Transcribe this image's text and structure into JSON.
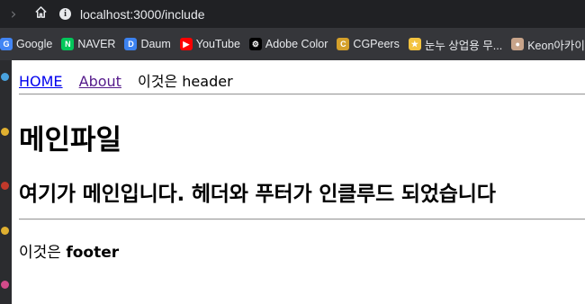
{
  "browser": {
    "url": "localhost:3000/include",
    "bookmarks": [
      {
        "label": "Google",
        "icon": "google-icon",
        "color": "#4285f4"
      },
      {
        "label": "NAVER",
        "icon": "naver-icon",
        "color": "#03c75a"
      },
      {
        "label": "Daum",
        "icon": "daum-icon",
        "color": "#3c82f0"
      },
      {
        "label": "YouTube",
        "icon": "youtube-icon",
        "color": "#ff0000"
      },
      {
        "label": "Adobe Color",
        "icon": "adobe-color-icon",
        "color": "#000000"
      },
      {
        "label": "CGPeers",
        "icon": "cgpeers-icon",
        "color": "#d4a02a"
      },
      {
        "label": "눈누 상업용 무...",
        "icon": "noonnu-icon",
        "color": "#f3c340"
      },
      {
        "label": "Keon아카이브",
        "icon": "keon-icon",
        "color": "#c8a48a"
      }
    ]
  },
  "page": {
    "nav": {
      "home": "HOME",
      "about": "About",
      "header_text": "이것은 header"
    },
    "title": "메인파일",
    "subtitle": "여기가 메인입니다. 헤더와 푸터가 인클루드 되었습니다",
    "footer_prefix": "이것은 ",
    "footer_bold": "footer"
  },
  "colors": {
    "link": "#0000ee",
    "visited_link": "#551a8b",
    "toolbar": "#202124",
    "bookmarks_bar": "#35363a"
  }
}
